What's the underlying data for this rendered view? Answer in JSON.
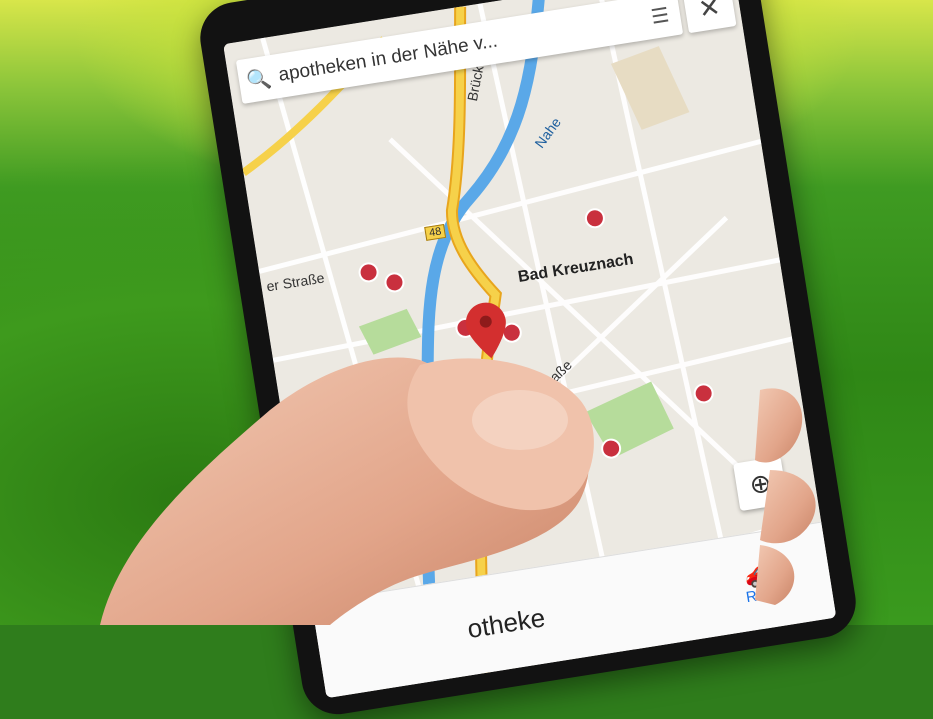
{
  "search": {
    "query": "apotheken in der Nähe v...",
    "search_icon": "search-icon",
    "list_icon": "list-icon",
    "close_icon": "close-icon"
  },
  "map": {
    "labels": {
      "city": "Bad Kreuznach",
      "river": "Nahe",
      "street1": "er Straße",
      "street2": "Ringstraße",
      "street3": "Brück",
      "road_number": "48"
    },
    "pin_color": "#d32f2f",
    "pharmacy_icon": "pharmacy-marker-icon"
  },
  "locate": {
    "icon": "my-location-icon"
  },
  "bottom": {
    "title": "otheke",
    "route_label": "Route",
    "route_icon": "car-icon"
  },
  "colors": {
    "accent": "#1a73e8",
    "grass": "#3f9b22",
    "highway": "#f2c23c",
    "water": "#5aa8e8"
  }
}
